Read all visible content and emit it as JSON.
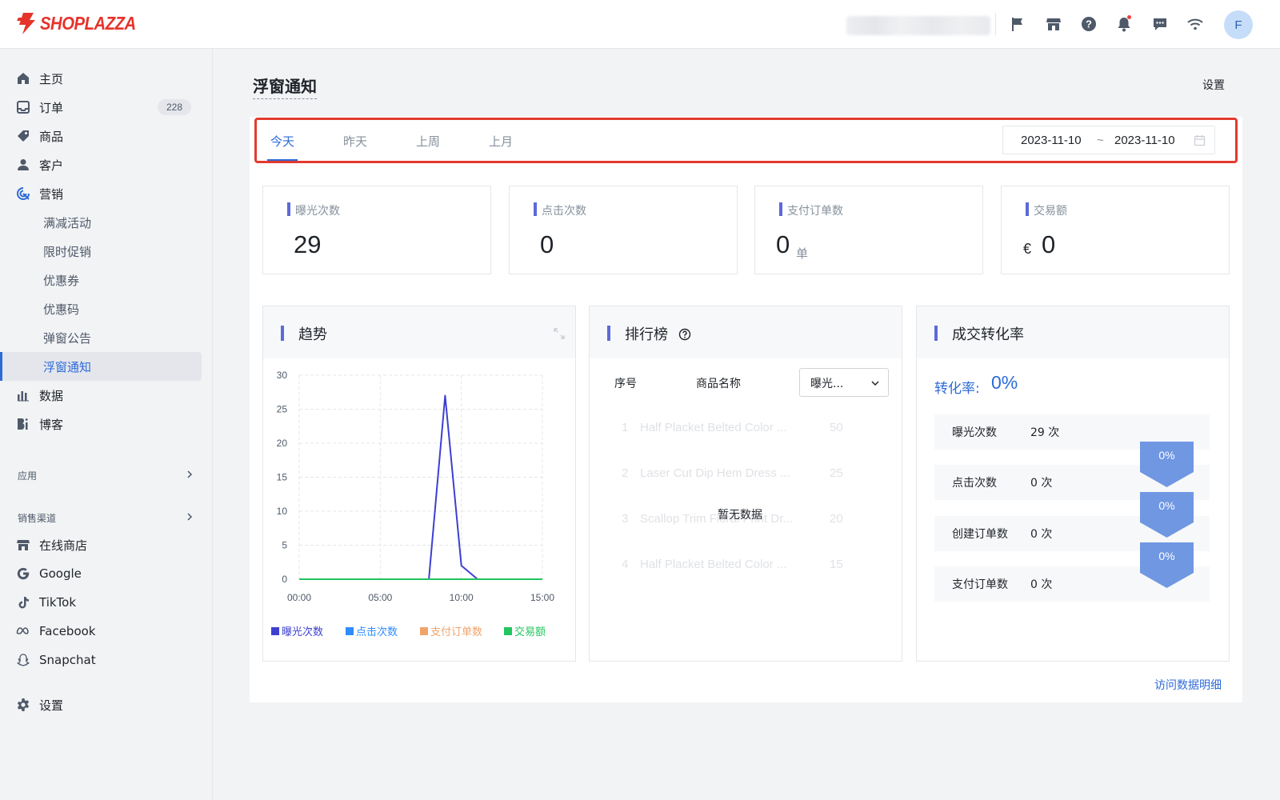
{
  "header": {
    "brand": "SHOPLAZZA",
    "brand_color": "#e6332a",
    "icons": [
      "flag-icon",
      "store-icon",
      "help-icon",
      "bell-icon",
      "chat-icon",
      "wifi-icon"
    ],
    "avatar_initial": "F"
  },
  "sidebar": {
    "items": [
      {
        "label": "主页",
        "icon": "home-icon"
      },
      {
        "label": "订单",
        "icon": "inbox-icon",
        "badge": "228"
      },
      {
        "label": "商品",
        "icon": "tag-icon"
      },
      {
        "label": "客户",
        "icon": "user-icon"
      },
      {
        "label": "营销",
        "icon": "marketing-icon"
      }
    ],
    "marketing_sub": [
      "满减活动",
      "限时促销",
      "优惠券",
      "优惠码",
      "弹窗公告",
      "浮窗通知"
    ],
    "active_sub": "浮窗通知",
    "items2": [
      {
        "label": "数据",
        "icon": "bar-chart-icon"
      },
      {
        "label": "博客",
        "icon": "blog-icon"
      }
    ],
    "apps_title": "应用",
    "channels_title": "销售渠道",
    "channels": [
      {
        "label": "在线商店",
        "icon": "store-icon"
      },
      {
        "label": "Google",
        "icon": "google-icon"
      },
      {
        "label": "TikTok",
        "icon": "tiktok-icon"
      },
      {
        "label": "Facebook",
        "icon": "meta-icon"
      },
      {
        "label": "Snapchat",
        "icon": "snapchat-icon"
      }
    ],
    "settings": "设置"
  },
  "page": {
    "title": "浮窗通知",
    "settings_link": "设置",
    "tabs": [
      "今天",
      "昨天",
      "上周",
      "上月"
    ],
    "active_tab": "今天",
    "date_start": "2023-11-10",
    "date_sep": "~",
    "date_end": "2023-11-10",
    "kpis": [
      {
        "label": "曝光次数",
        "value": "29"
      },
      {
        "label": "点击次数",
        "value": "0"
      },
      {
        "label": "支付订单数",
        "value": "0",
        "unit": "单"
      },
      {
        "label": "交易额",
        "value": "0",
        "currency": "€"
      }
    ],
    "trend_title": "趋势",
    "ranking_title": "排行榜",
    "ranking_cols": [
      "序号",
      "商品名称"
    ],
    "ranking_select": "曝光...",
    "ranking_rows": [
      {
        "idx": "1",
        "name": "Half Placket Belted Color ...",
        "count": "50"
      },
      {
        "idx": "2",
        "name": "Laser Cut Dip Hem Dress ...",
        "count": "25"
      },
      {
        "idx": "3",
        "name": "Scallop Trim Floral Print Dr...",
        "count": "20"
      },
      {
        "idx": "4",
        "name": "Half Placket Belted Color ...",
        "count": "15"
      }
    ],
    "no_data": "暂无数据",
    "conversion_title": "成交转化率",
    "conversion_label": "转化率:",
    "conversion_value": "0%",
    "funnel": [
      {
        "label": "曝光次数",
        "value": "29 次"
      },
      {
        "label": "点击次数",
        "value": "0 次"
      },
      {
        "label": "创建订单数",
        "value": "0 次"
      },
      {
        "label": "支付订单数",
        "value": "0 次"
      }
    ],
    "funnel_rates": [
      "0%",
      "0%",
      "0%"
    ],
    "detail_link": "访问数据明细"
  },
  "chart_data": {
    "type": "line",
    "x": [
      "00:00",
      "01:00",
      "02:00",
      "03:00",
      "04:00",
      "05:00",
      "06:00",
      "07:00",
      "08:00",
      "09:00",
      "10:00",
      "11:00",
      "12:00",
      "13:00",
      "14:00",
      "15:00"
    ],
    "x_ticks": [
      "00:00",
      "05:00",
      "10:00",
      "15:00"
    ],
    "ylim": [
      0,
      30
    ],
    "y_ticks": [
      0,
      5,
      10,
      15,
      20,
      25,
      30
    ],
    "grid": true,
    "legend_position": "bottom",
    "series": [
      {
        "name": "曝光次数",
        "color": "#3d3fd1",
        "values": [
          0,
          0,
          0,
          0,
          0,
          0,
          0,
          0,
          0,
          27,
          2,
          0,
          0,
          0,
          0,
          0
        ]
      },
      {
        "name": "点击次数",
        "color": "#2f8cff",
        "values": [
          0,
          0,
          0,
          0,
          0,
          0,
          0,
          0,
          0,
          0,
          0,
          0,
          0,
          0,
          0,
          0
        ]
      },
      {
        "name": "支付订单数",
        "color": "#f0a46c",
        "values": [
          0,
          0,
          0,
          0,
          0,
          0,
          0,
          0,
          0,
          0,
          0,
          0,
          0,
          0,
          0,
          0
        ]
      },
      {
        "name": "交易额",
        "color": "#22c55e",
        "values": [
          0,
          0,
          0,
          0,
          0,
          0,
          0,
          0,
          0,
          0,
          0,
          0,
          0,
          0,
          0,
          0
        ]
      }
    ]
  }
}
